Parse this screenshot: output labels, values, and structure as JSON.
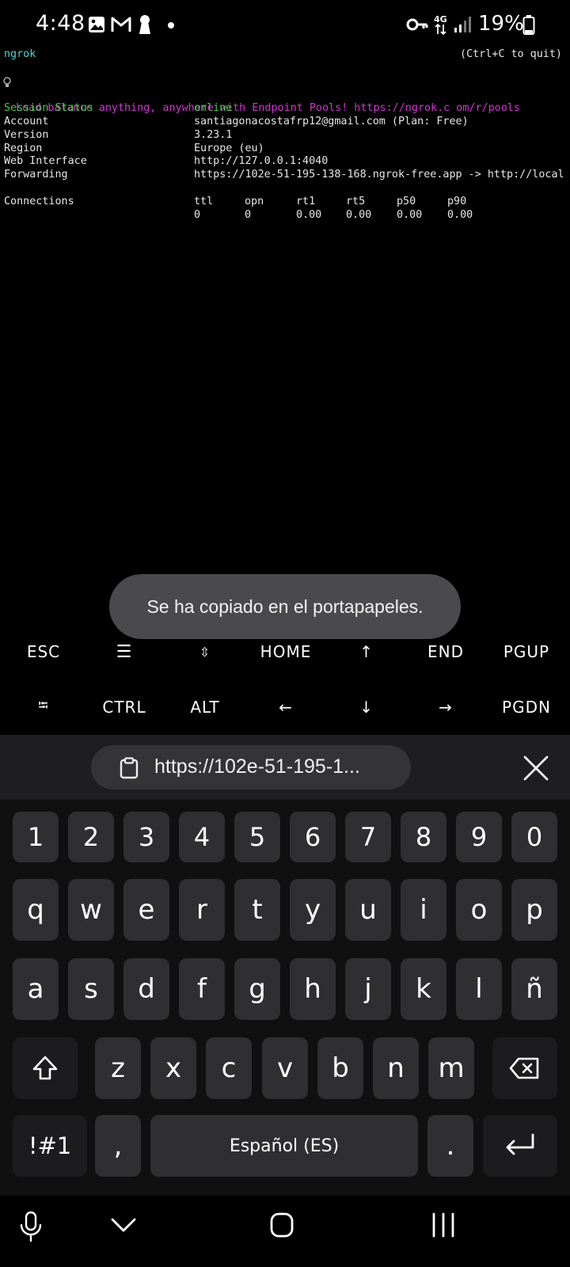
{
  "status_bar": {
    "time": "4:48",
    "battery_percent": "19%",
    "network": "4G"
  },
  "terminal": {
    "app_name": "ngrok",
    "quit_hint": "(Ctrl+C to quit)",
    "banner": "Load balance anything, anywhere with Endpoint Pools! https://ngrok.c om/r/pools",
    "session_status_label": "Session Status",
    "session_status_value": "online",
    "account_label": "Account",
    "account_value": "santiagonacostafrp12@gmail.com (Plan: Free)",
    "version_label": "Version",
    "version_value": "3.23.1",
    "region_label": "Region",
    "region_value": "Europe (eu)",
    "web_interface_label": "Web Interface",
    "web_interface_value": "http://127.0.0.1:4040",
    "forwarding_label": "Forwarding",
    "forwarding_value": "https://102e-51-195-138-168.ngrok-free.app -> http://local",
    "connections_label": "Connections",
    "connections_headers": [
      "ttl",
      "opn",
      "rt1",
      "rt5",
      "p50",
      "p90"
    ],
    "connections_values": [
      "0",
      "0",
      "0.00",
      "0.00",
      "0.00",
      "0.00"
    ]
  },
  "toast": {
    "message": "Se ha copiado en el portapapeles."
  },
  "extra_keys": {
    "row1": [
      "ESC",
      "☰",
      "⇳",
      "HOME",
      "↑",
      "END",
      "PGUP"
    ],
    "row2": [
      "⭾",
      "CTRL",
      "ALT",
      "←",
      "↓",
      "→",
      "PGDN"
    ]
  },
  "clipboard": {
    "text": "https://102e-51-195-1..."
  },
  "keyboard": {
    "numbers": [
      "1",
      "2",
      "3",
      "4",
      "5",
      "6",
      "7",
      "8",
      "9",
      "0"
    ],
    "row1": [
      "q",
      "w",
      "e",
      "r",
      "t",
      "y",
      "u",
      "i",
      "o",
      "p"
    ],
    "row2": [
      "a",
      "s",
      "d",
      "f",
      "g",
      "h",
      "j",
      "k",
      "l",
      "ñ"
    ],
    "row3": [
      "z",
      "x",
      "c",
      "v",
      "b",
      "n",
      "m"
    ],
    "symbols_label": "!#1",
    "comma": ",",
    "space_label": "Español (ES)",
    "period": "."
  },
  "colors": {
    "terminal_cyan": "#4fd6d6",
    "terminal_magenta": "#d633d6",
    "terminal_green": "#3ccf3c",
    "key_bg": "#2f2f31",
    "toast_bg": "#4a4a4c"
  }
}
